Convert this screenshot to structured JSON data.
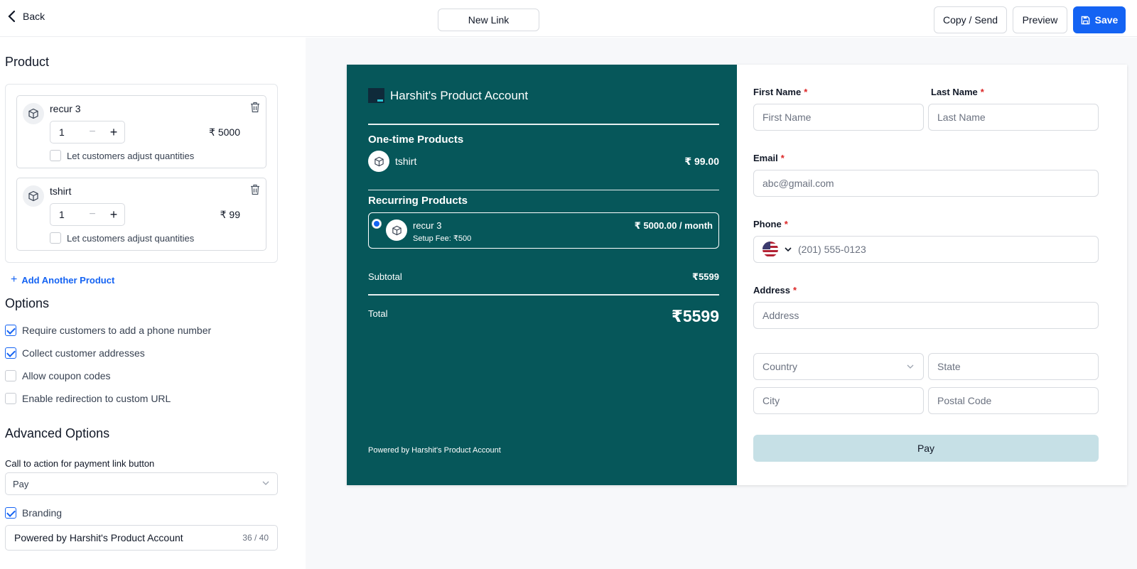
{
  "topbar": {
    "back_label": "Back",
    "link_name": "New Link",
    "copy_label": "Copy / Send",
    "preview_label": "Preview",
    "save_label": "Save"
  },
  "left": {
    "product_heading": "Product",
    "products": [
      {
        "name": "recur 3",
        "qty": "1",
        "price": "₹ 5000",
        "adjust_label": "Let customers adjust quantities",
        "adjust_checked": false
      },
      {
        "name": "tshirt",
        "qty": "1",
        "price": "₹ 99",
        "adjust_label": "Let customers adjust quantities",
        "adjust_checked": false
      }
    ],
    "add_product_label": "Add Another Product",
    "options_heading": "Options",
    "options": [
      {
        "label": "Require customers to add a phone number",
        "checked": true
      },
      {
        "label": "Collect customer addresses",
        "checked": true
      },
      {
        "label": "Allow coupon codes",
        "checked": false
      },
      {
        "label": "Enable redirection to custom URL",
        "checked": false
      }
    ],
    "advanced_heading": "Advanced Options",
    "cta_label": "Call to action for payment link button",
    "cta_value": "Pay",
    "branding_label": "Branding",
    "branding_checked": true,
    "branding_value": "Powered by Harshit's Product Account",
    "branding_count": "36 / 40"
  },
  "summary": {
    "account_name": "Harshit's Product Account",
    "one_time_heading": "One-time Products",
    "one_time_items": [
      {
        "name": "tshirt",
        "price": "₹ 99.00"
      }
    ],
    "recurring_heading": "Recurring Products",
    "recurring_item": {
      "name": "recur 3",
      "fee": "Setup Fee: ₹500",
      "price": "₹ 5000.00 / month"
    },
    "subtotal_label": "Subtotal",
    "subtotal_value": "₹5599",
    "total_label": "Total",
    "total_value": "₹5599",
    "powered_by": "Powered by Harshit's Product Account",
    "bg_color": "#06575a"
  },
  "form": {
    "first_name_label": "First Name",
    "first_name_placeholder": "First Name",
    "last_name_label": "Last Name",
    "last_name_placeholder": "Last Name",
    "email_label": "Email",
    "email_placeholder": "abc@gmail.com",
    "phone_label": "Phone",
    "phone_placeholder": "(201) 555-0123",
    "address_label": "Address",
    "address_placeholder": "Address",
    "country_placeholder": "Country",
    "state_placeholder": "State",
    "city_placeholder": "City",
    "postal_placeholder": "Postal Code",
    "pay_label": "Pay"
  },
  "colors": {
    "accent": "#1463f3",
    "summary_bg": "#06575a",
    "pay_button": "#c6e0e6",
    "required": "#dc2626"
  }
}
